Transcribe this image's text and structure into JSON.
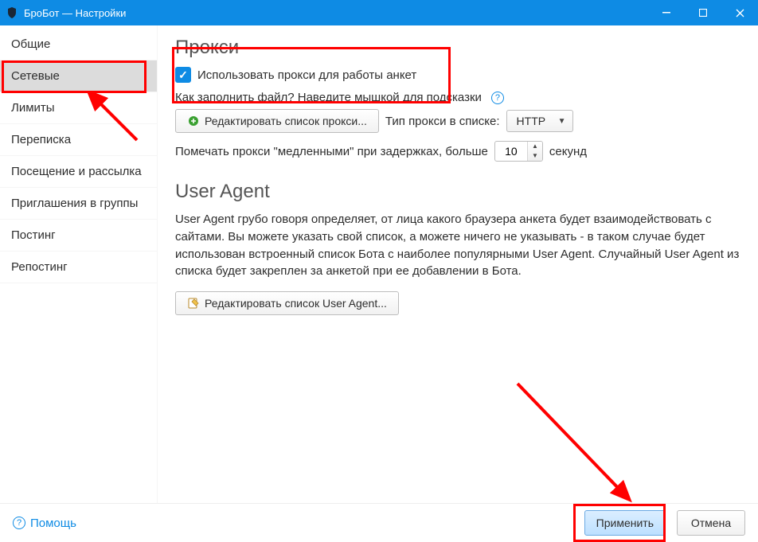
{
  "window": {
    "title": "БроБот — Настройки"
  },
  "sidebar": {
    "items": [
      {
        "label": "Общие"
      },
      {
        "label": "Сетевые"
      },
      {
        "label": "Лимиты"
      },
      {
        "label": "Переписка"
      },
      {
        "label": "Посещение и рассылка"
      },
      {
        "label": "Приглашения в группы"
      },
      {
        "label": "Постинг"
      },
      {
        "label": "Репостинг"
      }
    ],
    "selected_index": 1
  },
  "proxy": {
    "heading": "Прокси",
    "use_proxy_label": "Использовать прокси для работы анкет",
    "use_proxy_checked": true,
    "hint_text": "Как заполнить файл? Наведите мышкой для подсказки",
    "edit_list_button": "Редактировать список прокси...",
    "type_label": "Тип прокси в списке:",
    "type_value": "HTTP",
    "slow_label_prefix": "Помечать прокси \"медленными\" при задержках, больше",
    "slow_value": "10",
    "slow_label_suffix": "секунд"
  },
  "user_agent": {
    "heading": "User Agent",
    "description": "User Agent грубо говоря определяет, от лица какого браузера анкета будет взаимодействовать с сайтами. Вы можете указать свой список, а можете ничего не указывать - в таком случае будет использован встроенный список Бота с наиболее популярными User Agent. Случайный User Agent из списка будет закреплен за анкетой при ее добавлении в Бота.",
    "edit_list_button": "Редактировать список User Agent..."
  },
  "footer": {
    "help": "Помощь",
    "apply": "Применить",
    "cancel": "Отмена"
  }
}
